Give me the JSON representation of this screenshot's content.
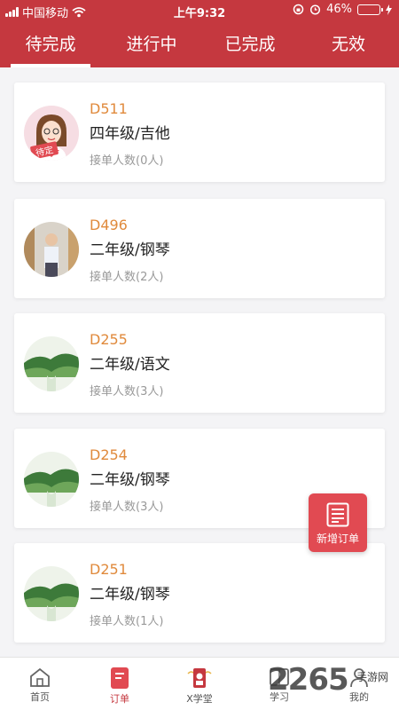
{
  "status": {
    "carrier": "中国移动",
    "time": "上午9:32",
    "battery": "46%"
  },
  "tabs": [
    "待完成",
    "进行中",
    "已完成",
    "无效"
  ],
  "active_tab": 0,
  "orders": [
    {
      "code": "D511",
      "title": "四年级/吉他",
      "count": "接单人数(0人)",
      "badge": "待定",
      "avatar": "girl-cartoon"
    },
    {
      "code": "D496",
      "title": "二年级/钢琴",
      "count": "接单人数(2人)",
      "avatar": "teacher-photo"
    },
    {
      "code": "D255",
      "title": "二年级/语文",
      "count": "接单人数(3人)",
      "avatar": "landscape"
    },
    {
      "code": "D254",
      "title": "二年级/钢琴",
      "count": "接单人数(3人)",
      "avatar": "landscape"
    },
    {
      "code": "D251",
      "title": "二年级/钢琴",
      "count": "接单人数(1人)",
      "avatar": "landscape"
    }
  ],
  "fab": {
    "label": "新增订单",
    "icon": "document-list-icon"
  },
  "bottom_nav": [
    {
      "label": "首页",
      "icon": "home-icon"
    },
    {
      "label": "订单",
      "icon": "order-icon"
    },
    {
      "label": "X学堂",
      "icon": "school-icon"
    },
    {
      "label": "学习",
      "icon": "study-icon"
    },
    {
      "label": "我的",
      "icon": "profile-icon"
    }
  ],
  "active_nav": 1,
  "watermark": {
    "big": "2265",
    "small": "手游网"
  },
  "colors": {
    "primary": "#c5383f",
    "accent_code": "#e08a3c",
    "fab": "#e14a52"
  }
}
